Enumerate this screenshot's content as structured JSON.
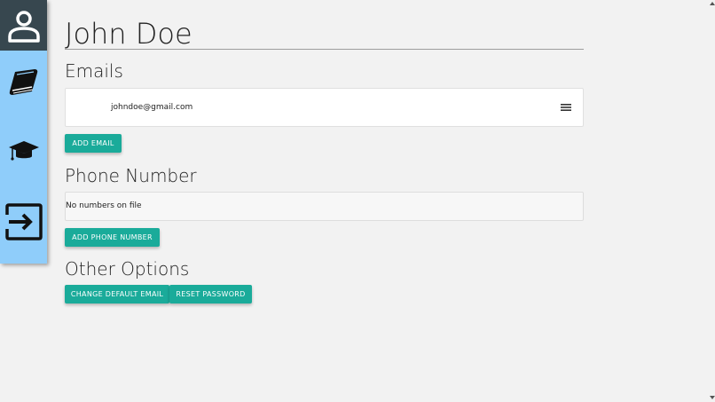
{
  "profile": {
    "name": "John Doe"
  },
  "sidebar": {
    "items": [
      {
        "icon": "user-icon"
      },
      {
        "icon": "book-icon"
      },
      {
        "icon": "graduation-cap-icon"
      },
      {
        "icon": "logout-icon"
      }
    ]
  },
  "emails": {
    "title": "Emails",
    "items": [
      "johndoe@gmail.com"
    ],
    "menu_icon": "hamburger-menu-icon",
    "add_label": "Add Email"
  },
  "phone": {
    "title": "Phone Number",
    "empty_text": "No numbers on file",
    "add_label": "Add Phone Number"
  },
  "options": {
    "title": "Other Options",
    "change_default_email_label": "Change Default Email",
    "reset_password_label": "Reset Password"
  },
  "colors": {
    "sidebar_bg": "#8fcdfa",
    "sidebar_active": "#37474f",
    "button": "#1aab9a",
    "page_bg": "#f2f2f2"
  }
}
